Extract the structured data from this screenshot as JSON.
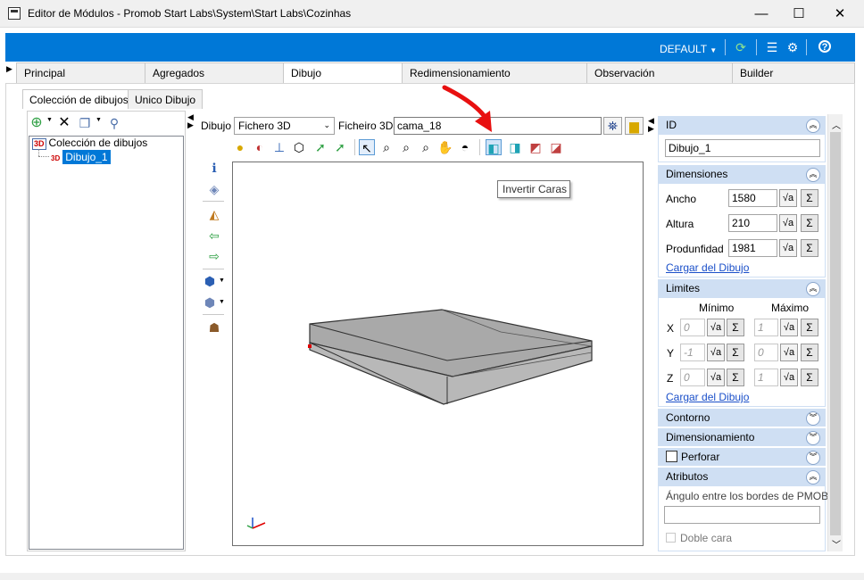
{
  "window": {
    "title": "Editor de Módulos - Promob Start Labs\\System\\Start Labs\\Cozinhas",
    "minimize": "—",
    "maximize": "☐",
    "close": "✕"
  },
  "header": {
    "profile": "DEFAULT",
    "accent": "#0078d7"
  },
  "tabs": [
    "Principal",
    "Agregados",
    "Dibujo",
    "Redimensionamiento",
    "Observación",
    "Builder"
  ],
  "active_tab": "Dibujo",
  "subtabs": [
    "Colección de dibujos",
    "Unico Dibujo"
  ],
  "tree": {
    "root_badge": "3D",
    "root": "Colección de dibujos",
    "child_badge": "3D",
    "child": "Dibujo_1"
  },
  "drawing": {
    "dibujo_label": "Dibujo",
    "dibujo_value": "Fichero 3D",
    "ficheiro_label": "Ficheiro 3D",
    "ficheiro_value": "cama_18",
    "tooltip": "Invertir Caras"
  },
  "right_panel": {
    "id": {
      "header": "ID",
      "value": "Dibujo_1"
    },
    "dimensiones": {
      "header": "Dimensiones",
      "ancho_label": "Ancho",
      "ancho": "1580",
      "altura_label": "Altura",
      "altura": "210",
      "profundidad_label": "Produnfidad",
      "profundidad": "1981",
      "link": "Cargar del Dibujo"
    },
    "limites": {
      "header": "Limites",
      "min_label": "Mínimo",
      "max_label": "Máximo",
      "x_label": "X",
      "x_min": "0",
      "x_max": "1",
      "y_label": "Y",
      "y_min": "-1",
      "y_max": "0",
      "z_label": "Z",
      "z_min": "0",
      "z_max": "1",
      "link": "Cargar del Dibujo"
    },
    "contorno": "Contorno",
    "dimensionamiento": "Dimensionamiento",
    "perforar": "Perforar",
    "atributos": {
      "header": "Atributos",
      "angulo_label": "Ángulo entre los bordes de PMOB",
      "angulo_value": "",
      "doble_cara": "Doble cara"
    },
    "sqrt_symbol": "√a",
    "sigma_symbol": "Σ"
  }
}
